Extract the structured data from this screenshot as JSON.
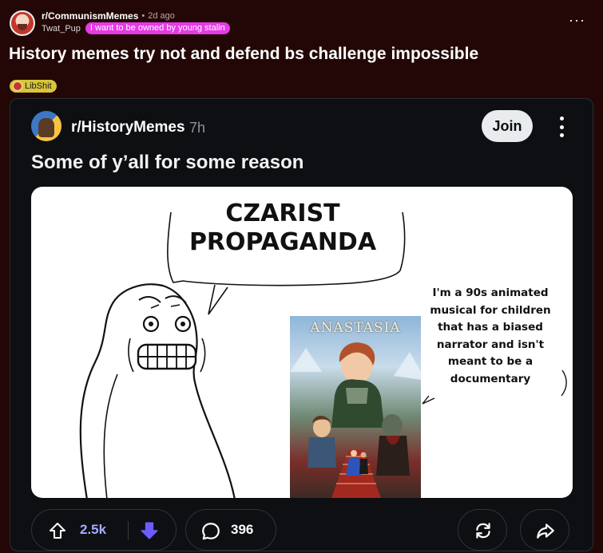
{
  "post": {
    "subreddit": "r/CommunismMemes",
    "dot": "•",
    "time": "2d ago",
    "author": "Twat_Pup",
    "user_flair": "I want to be owned by young stalin",
    "more": "···",
    "title": "History memes try not and defend bs challenge impossible",
    "post_flair": "LibShit"
  },
  "embed": {
    "subreddit": "r/HistoryMemes",
    "time": "7h",
    "join_label": "Join",
    "title": "Some of y’all for some reason",
    "meme": {
      "bubble_lines": [
        "CZARIST",
        "PROPAGANDA"
      ],
      "side_lines": [
        "I'm a 90s animated",
        "musical for children",
        "that has a biased",
        "narrator and isn't",
        "meant to be a",
        "documentary"
      ],
      "poster_title": "ANASTASIA"
    },
    "actions": {
      "upvotes": "2.5k",
      "comments": "396"
    }
  },
  "colors": {
    "page_background": "#230706",
    "user_flair": "#e63ae6",
    "post_flair": "#d8c53a",
    "vote_count": "#a7aaff",
    "downvote_active": "#6a5cff"
  }
}
